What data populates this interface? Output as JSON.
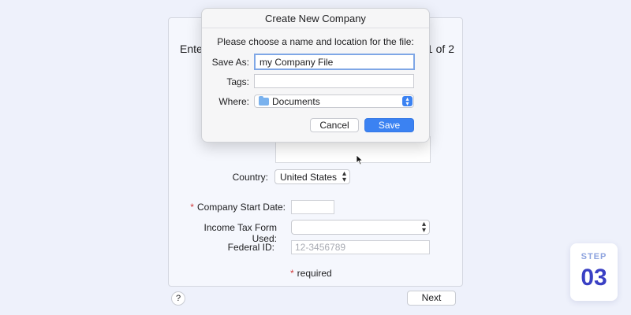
{
  "window": {
    "title_partial": "Ente",
    "page_partial": "1 of 2"
  },
  "form": {
    "country_label": "Country:",
    "country_value": "United States",
    "start_date_label": "Company Start Date:",
    "start_date_value": "",
    "tax_form_label": "Income Tax Form Used:",
    "tax_form_value": "",
    "federal_id_label": "Federal ID:",
    "federal_id_placeholder": "12-3456789",
    "required_note": "required",
    "required_star": "*"
  },
  "footer": {
    "help_label": "?",
    "next_label": "Next"
  },
  "dialog": {
    "title": "Create New Company",
    "prompt": "Please choose a name and location for the file:",
    "save_as_label": "Save As:",
    "save_as_value": "my Company File",
    "tags_label": "Tags:",
    "tags_value": "",
    "where_label": "Where:",
    "where_value": "Documents",
    "cancel_label": "Cancel",
    "save_label": "Save"
  },
  "step_badge": {
    "word": "STEP",
    "number": "03"
  },
  "icons": {
    "folder": "folder-icon",
    "stepper": "chevron-up-down-icon",
    "cursor": "mouse-pointer-icon"
  },
  "colors": {
    "accent": "#3b82f2",
    "required": "#d13b3b",
    "step_number": "#3a40c4",
    "background": "#eef1fb"
  }
}
